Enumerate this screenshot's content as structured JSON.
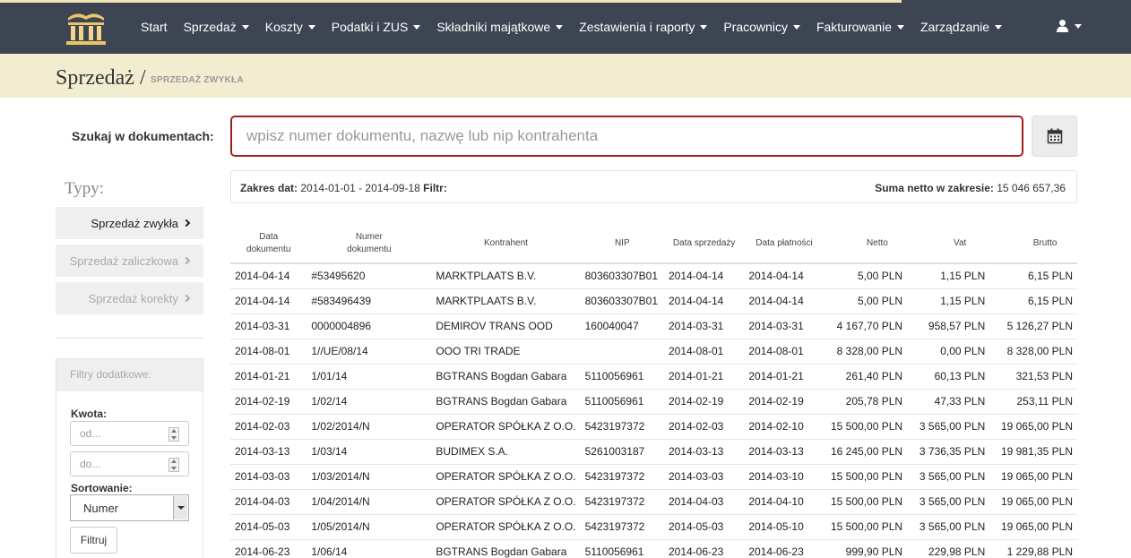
{
  "nav": {
    "items": [
      {
        "label": "Start",
        "caret": false
      },
      {
        "label": "Sprzedaż",
        "caret": true
      },
      {
        "label": "Koszty",
        "caret": true
      },
      {
        "label": "Podatki i ZUS",
        "caret": true
      },
      {
        "label": "Składniki majątkowe",
        "caret": true
      },
      {
        "label": "Zestawienia i raporty",
        "caret": true
      },
      {
        "label": "Pracownicy",
        "caret": true
      },
      {
        "label": "Fakturowanie",
        "caret": true
      },
      {
        "label": "Zarządzanie",
        "caret": true
      }
    ],
    "logo_icon": "library-icon",
    "user_icon": "user-icon"
  },
  "header": {
    "title": "Sprzedaż",
    "separator": "/",
    "subtitle": "SPRZEDAŻ ZWYKŁA"
  },
  "search": {
    "label": "Szukaj w dokumentach:",
    "placeholder": "wpisz numer dokumentu, nazwę lub nip kontrahenta",
    "calendar_icon": "calendar-icon"
  },
  "sidebar": {
    "types_title": "Typy:",
    "types": [
      {
        "label": "Sprzedaż zwykła",
        "active": true
      },
      {
        "label": "Sprzedaż zaliczkowa",
        "active": false
      },
      {
        "label": "Sprzedaż korekty",
        "active": false
      }
    ],
    "filters": {
      "title": "Filtry dodatkowe:",
      "amount_label": "Kwota:",
      "from_placeholder": "od...",
      "to_placeholder": "do...",
      "sort_label": "Sortowanie:",
      "sort_value": "Numer",
      "apply_label": "Filtruj"
    }
  },
  "info": {
    "date_range_label": "Zakres dat:",
    "date_range_value": "2014-01-01 - 2014-09-18",
    "filter_label": "Filtr:",
    "sum_label": "Suma netto w zakresie:",
    "sum_value": "15 046 657,36"
  },
  "table": {
    "headers": [
      "Data dokumentu",
      "Numer dokumentu",
      "Kontrahent",
      "NIP",
      "Data sprzedaży",
      "Data płatności",
      "Netto",
      "Vat",
      "Brutto"
    ],
    "rows": [
      [
        "2014-04-14",
        "#53495620",
        "MARKTPLAATS B.V.",
        "803603307B01",
        "2014-04-14",
        "2014-04-14",
        "5,00 PLN",
        "1,15 PLN",
        "6,15 PLN"
      ],
      [
        "2014-04-14",
        "#583496439",
        "MARKTPLAATS B.V.",
        "803603307B01",
        "2014-04-14",
        "2014-04-14",
        "5,00 PLN",
        "1,15 PLN",
        "6,15 PLN"
      ],
      [
        "2014-03-31",
        "0000004896",
        "DEMIROV TRANS OOD",
        "160040047",
        "2014-03-31",
        "2014-03-31",
        "4 167,70 PLN",
        "958,57 PLN",
        "5 126,27 PLN"
      ],
      [
        "2014-08-01",
        "1//UE/08/14",
        "OOO TRI TRADE",
        "",
        "2014-08-01",
        "2014-08-01",
        "8 328,00 PLN",
        "0,00 PLN",
        "8 328,00 PLN"
      ],
      [
        "2014-01-21",
        "1/01/14",
        "BGTRANS Bogdan Gabara",
        "5110056961",
        "2014-01-21",
        "2014-01-21",
        "261,40 PLN",
        "60,13 PLN",
        "321,53 PLN"
      ],
      [
        "2014-02-19",
        "1/02/14",
        "BGTRANS Bogdan Gabara",
        "5110056961",
        "2014-02-19",
        "2014-02-19",
        "205,78 PLN",
        "47,33 PLN",
        "253,11 PLN"
      ],
      [
        "2014-02-03",
        "1/02/2014/N",
        "OPERATOR SPÓŁKA Z O.O.",
        "5423197372",
        "2014-02-03",
        "2014-02-10",
        "15 500,00 PLN",
        "3 565,00 PLN",
        "19 065,00 PLN"
      ],
      [
        "2014-03-13",
        "1/03/14",
        "BUDIMEX S.A.",
        "5261003187",
        "2014-03-13",
        "2014-03-13",
        "16 245,00 PLN",
        "3 736,35 PLN",
        "19 981,35 PLN"
      ],
      [
        "2014-03-03",
        "1/03/2014/N",
        "OPERATOR SPÓŁKA Z O.O.",
        "5423197372",
        "2014-03-03",
        "2014-03-10",
        "15 500,00 PLN",
        "3 565,00 PLN",
        "19 065,00 PLN"
      ],
      [
        "2014-04-03",
        "1/04/2014/N",
        "OPERATOR SPÓŁKA Z O.O.",
        "5423197372",
        "2014-04-03",
        "2014-04-10",
        "15 500,00 PLN",
        "3 565,00 PLN",
        "19 065,00 PLN"
      ],
      [
        "2014-05-03",
        "1/05/2014/N",
        "OPERATOR SPÓŁKA Z O.O.",
        "5423197372",
        "2014-05-03",
        "2014-05-10",
        "15 500,00 PLN",
        "3 565,00 PLN",
        "19 065,00 PLN"
      ],
      [
        "2014-06-23",
        "1/06/14",
        "BGTRANS Bogdan Gabara",
        "5110056961",
        "2014-06-23",
        "2014-06-23",
        "999,90 PLN",
        "229,98 PLN",
        "1 229,88 PLN"
      ]
    ]
  },
  "colors": {
    "navbar": "#3d4452",
    "header_band": "#f2edd0",
    "search_border": "#a02020"
  }
}
